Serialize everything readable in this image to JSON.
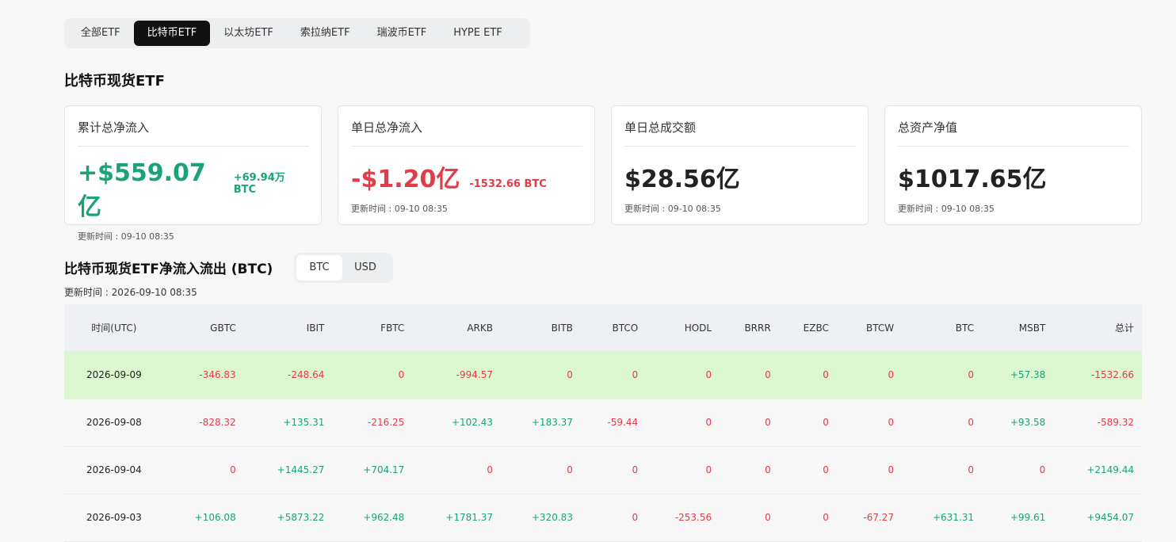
{
  "tabs": [
    {
      "label": "全部ETF",
      "active": false
    },
    {
      "label": "比特币ETF",
      "active": true
    },
    {
      "label": "以太坊ETF",
      "active": false
    },
    {
      "label": "索拉纳ETF",
      "active": false
    },
    {
      "label": "瑞波币ETF",
      "active": false
    },
    {
      "label": "HYPE ETF",
      "active": false
    }
  ],
  "section_title": "比特币现货ETF",
  "cards": [
    {
      "label": "累计总净流入",
      "value": "+$559.07亿",
      "sub": "+69.94万 BTC",
      "sign": "pos",
      "time": "更新时间 : 09-10 08:35"
    },
    {
      "label": "单日总净流入",
      "value": "-$1.20亿",
      "sub": "-1532.66 BTC",
      "sign": "neg",
      "time": "更新时间 : 09-10 08:35"
    },
    {
      "label": "单日总成交额",
      "value": "$28.56亿",
      "sub": "",
      "sign": "",
      "time": "更新时间 : 09-10 08:35"
    },
    {
      "label": "总资产净值",
      "value": "$1017.65亿",
      "sub": "",
      "sign": "",
      "time": "更新时间 : 09-10 08:35"
    }
  ],
  "flow": {
    "title": "比特币现货ETF净流入流出 (BTC)",
    "toggle": [
      "BTC",
      "USD"
    ],
    "toggle_active": "BTC",
    "updated": "更新时间 : 2026-09-10 08:35"
  },
  "table": {
    "headers": [
      "时间(UTC)",
      "GBTC",
      "IBIT",
      "FBTC",
      "ARKB",
      "BITB",
      "BTCO",
      "HODL",
      "BRRR",
      "EZBC",
      "BTCW",
      "BTC",
      "MSBT",
      "总计"
    ],
    "rows": [
      {
        "highlight": true,
        "cells": [
          "2026-09-09",
          "-346.83",
          "-248.64",
          "0",
          "-994.57",
          "0",
          "0",
          "0",
          "0",
          "0",
          "0",
          "0",
          "+57.38",
          "-1532.66"
        ]
      },
      {
        "highlight": false,
        "cells": [
          "2026-09-08",
          "-828.32",
          "+135.31",
          "-216.25",
          "+102.43",
          "+183.37",
          "-59.44",
          "0",
          "0",
          "0",
          "0",
          "0",
          "+93.58",
          "-589.32"
        ]
      },
      {
        "highlight": false,
        "cells": [
          "2026-09-04",
          "0",
          "+1445.27",
          "+704.17",
          "0",
          "0",
          "0",
          "0",
          "0",
          "0",
          "0",
          "0",
          "0",
          "+2149.44"
        ]
      },
      {
        "highlight": false,
        "cells": [
          "2026-09-03",
          "+106.08",
          "+5873.22",
          "+962.48",
          "+1781.37",
          "+320.83",
          "0",
          "-253.56",
          "0",
          "0",
          "-67.27",
          "+631.31",
          "+99.61",
          "+9454.07"
        ]
      }
    ]
  },
  "colors": {
    "positive": "#1ba27a",
    "negative": "#e03c4a",
    "highlight_row": "#daf7cf"
  }
}
